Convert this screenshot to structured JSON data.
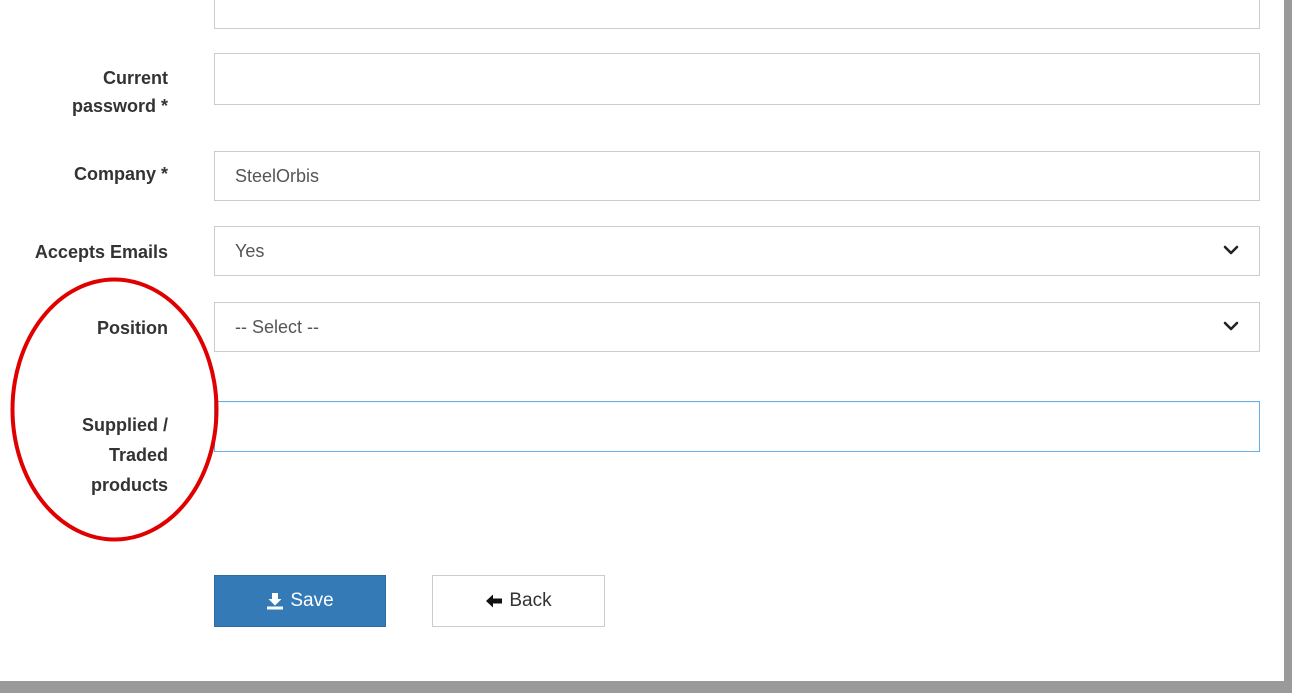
{
  "form": {
    "top_field": {
      "value": ""
    },
    "current_password": {
      "label_line1": "Current",
      "label_line2": "password *",
      "value": ""
    },
    "company": {
      "label": "Company *",
      "value": "SteelOrbis"
    },
    "accepts_emails": {
      "label": "Accepts Emails",
      "value": "Yes"
    },
    "position": {
      "label": "Position",
      "value": "-- Select --"
    },
    "supplied_traded_products": {
      "label_line1": "Supplied /",
      "label_line2": "Traded",
      "label_line3": "products",
      "value": ""
    }
  },
  "buttons": {
    "save_label": "Save",
    "back_label": "Back"
  },
  "icons": {
    "save": "download-icon",
    "back": "arrow-left-icon",
    "select": "chevron-down-icon"
  },
  "colors": {
    "primary": "#337ab7",
    "annotation": "#e00000",
    "focus_border": "#66afe9"
  }
}
